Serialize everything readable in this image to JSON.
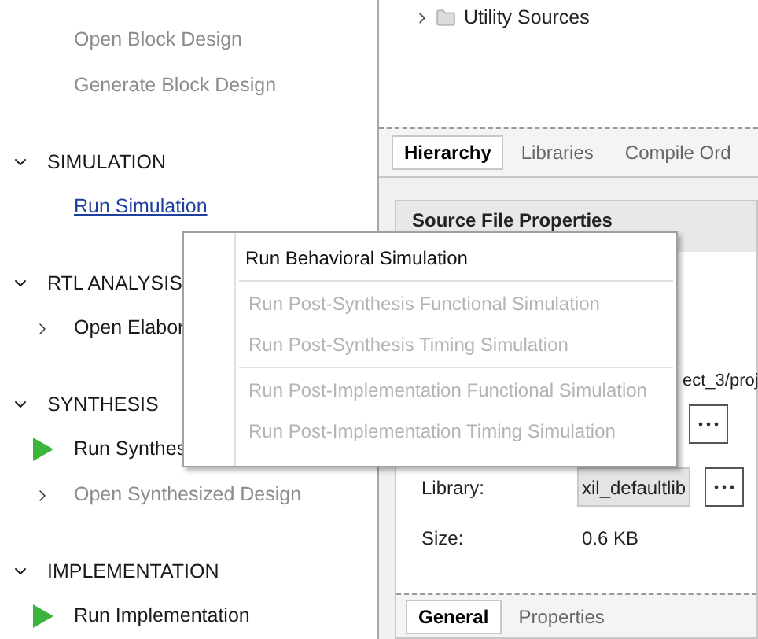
{
  "flow_navigator": {
    "items": [
      {
        "label": "Open Block Design",
        "kind": "plain",
        "disabled": true
      },
      {
        "label": "Generate Block Design",
        "kind": "plain",
        "disabled": true
      }
    ],
    "sections": [
      {
        "title": "SIMULATION",
        "expanded": true,
        "items": [
          {
            "label": "Run Simulation",
            "kind": "link",
            "disabled": false
          }
        ]
      },
      {
        "title": "RTL ANALYSIS",
        "expanded": true,
        "items": [
          {
            "label": "Open Elabor",
            "kind": "expandable",
            "disabled": false
          }
        ]
      },
      {
        "title": "SYNTHESIS",
        "expanded": true,
        "items": [
          {
            "label": "Run Synthes",
            "kind": "run",
            "disabled": false
          },
          {
            "label": "Open Synthesized Design",
            "kind": "expandable",
            "disabled": true
          }
        ]
      },
      {
        "title": "IMPLEMENTATION",
        "expanded": true,
        "items": [
          {
            "label": "Run Implementation",
            "kind": "run",
            "disabled": false
          }
        ]
      }
    ]
  },
  "sources": {
    "tree": [
      {
        "label": "Utility Sources",
        "expanded": false
      }
    ],
    "tabs": [
      {
        "label": "Hierarchy",
        "selected": true
      },
      {
        "label": "Libraries",
        "selected": false
      },
      {
        "label": "Compile Ord",
        "selected": false
      }
    ]
  },
  "properties": {
    "title": "Source File Properties",
    "location": "ect_3/proj",
    "library": {
      "label": "Library:",
      "value": "xil_defaultlib"
    },
    "size": {
      "label": "Size:",
      "value": "0.6 KB"
    },
    "tabs": [
      {
        "label": "General",
        "selected": true
      },
      {
        "label": "Properties",
        "selected": false
      }
    ]
  },
  "context_menu": {
    "groups": [
      [
        {
          "label": "Run Behavioral Simulation",
          "disabled": false
        }
      ],
      [
        {
          "label": "Run Post-Synthesis Functional Simulation",
          "disabled": true
        },
        {
          "label": "Run Post-Synthesis Timing Simulation",
          "disabled": true
        }
      ],
      [
        {
          "label": "Run Post-Implementation Functional Simulation",
          "disabled": true
        },
        {
          "label": "Run Post-Implementation Timing Simulation",
          "disabled": true
        }
      ]
    ]
  }
}
